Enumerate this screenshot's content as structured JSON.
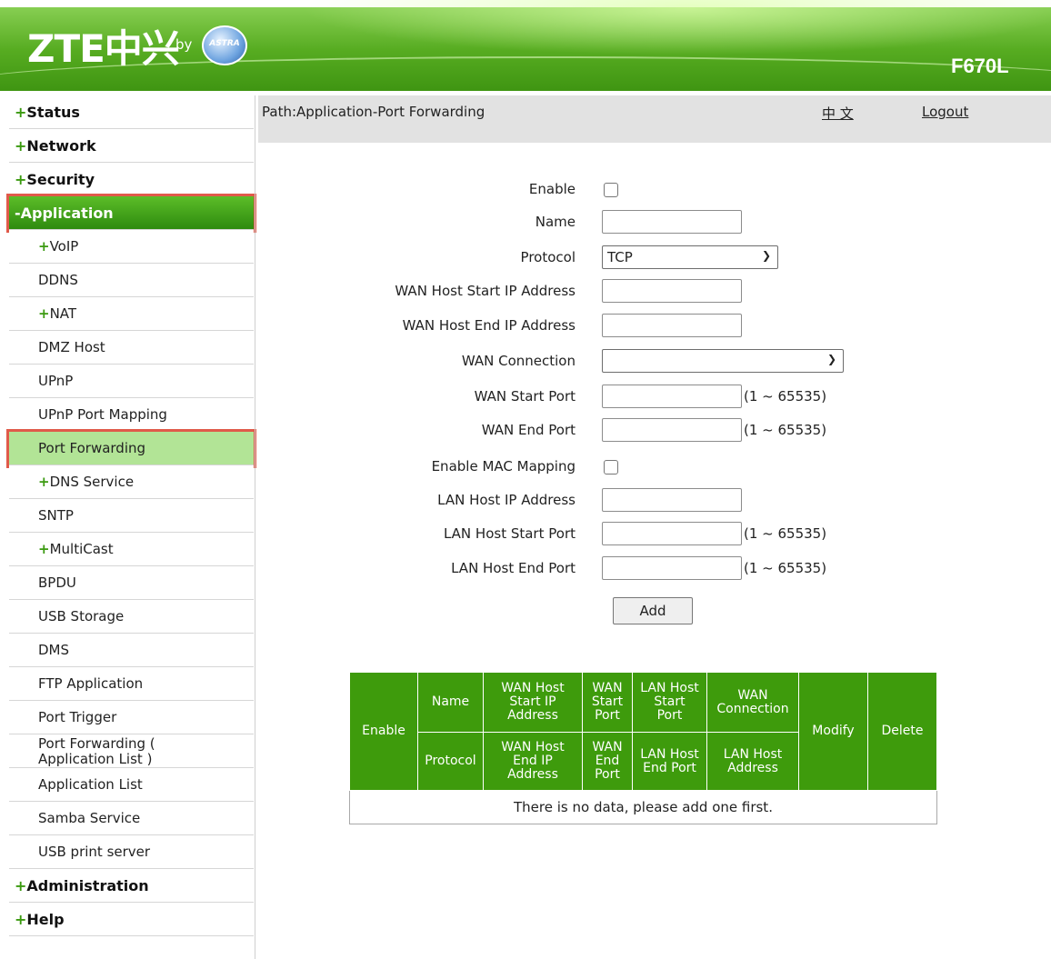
{
  "header": {
    "logo_text": "ZTE中兴",
    "logo_by": "by",
    "partner_logo": "ASTRA",
    "model": "F670L"
  },
  "sidebar": {
    "items": [
      {
        "label": "Status",
        "level": "top",
        "plus": true
      },
      {
        "label": "Network",
        "level": "top",
        "plus": true
      },
      {
        "label": "Security",
        "level": "top",
        "plus": true
      },
      {
        "label": "Application",
        "level": "top",
        "minus": true,
        "active": true
      },
      {
        "label": "VoIP",
        "level": "sub",
        "plus": true
      },
      {
        "label": "DDNS",
        "level": "sub"
      },
      {
        "label": "NAT",
        "level": "sub",
        "plus": true
      },
      {
        "label": "DMZ Host",
        "level": "sub"
      },
      {
        "label": "UPnP",
        "level": "sub"
      },
      {
        "label": "UPnP Port Mapping",
        "level": "sub"
      },
      {
        "label": "Port Forwarding",
        "level": "sub",
        "active": true
      },
      {
        "label": "DNS Service",
        "level": "sub",
        "plus": true
      },
      {
        "label": "SNTP",
        "level": "sub"
      },
      {
        "label": "MultiCast",
        "level": "sub",
        "plus": true
      },
      {
        "label": "BPDU",
        "level": "sub"
      },
      {
        "label": "USB Storage",
        "level": "sub"
      },
      {
        "label": "DMS",
        "level": "sub"
      },
      {
        "label": "FTP Application",
        "level": "sub"
      },
      {
        "label": "Port Trigger",
        "level": "sub"
      },
      {
        "label": "Port Forwarding ( Application List )",
        "level": "sub",
        "two_line": [
          "Port Forwarding (",
          " Application List )"
        ]
      },
      {
        "label": "Application List",
        "level": "sub"
      },
      {
        "label": "Samba Service",
        "level": "sub"
      },
      {
        "label": "USB print server",
        "level": "sub"
      },
      {
        "label": "Administration",
        "level": "top",
        "plus": true
      },
      {
        "label": "Help",
        "level": "top",
        "plus": true
      }
    ]
  },
  "pathbar": {
    "path": "Path:Application-Port Forwarding",
    "lang": "中 文",
    "logout": "Logout"
  },
  "form": {
    "enable_label": "Enable",
    "enable_checked": false,
    "name_label": "Name",
    "name_value": "",
    "protocol_label": "Protocol",
    "protocol_value": "TCP",
    "wan_host_start_ip_label": "WAN Host Start IP Address",
    "wan_host_end_ip_label": "WAN Host End IP Address",
    "wan_connection_label": "WAN Connection",
    "wan_connection_value": "",
    "wan_start_port_label": "WAN Start Port",
    "wan_end_port_label": "WAN End Port",
    "enable_mac_mapping_label": "Enable MAC Mapping",
    "lan_host_ip_label": "LAN Host IP Address",
    "lan_host_start_port_label": "LAN Host Start Port",
    "lan_host_end_port_label": "LAN Host End Port",
    "port_range_hint": "(1 ~ 65535)",
    "add_button": "Add"
  },
  "table": {
    "headers": {
      "enable": "Enable",
      "name": "Name",
      "wan_host_start_ip": [
        "WAN Host",
        "Start IP",
        "Address"
      ],
      "wan_start_port": [
        "WAN",
        "Start",
        "Port"
      ],
      "lan_host_start_port": [
        "LAN Host",
        "Start",
        "Port"
      ],
      "wan_connection": [
        "WAN",
        "Connection"
      ],
      "modify": "Modify",
      "delete": "Delete",
      "protocol": "Protocol",
      "wan_host_end_ip": [
        "WAN Host",
        "End IP",
        "Address"
      ],
      "wan_end_port": [
        "WAN",
        "End",
        "Port"
      ],
      "lan_host_end_port": [
        "LAN Host",
        "End Port"
      ],
      "lan_host_address": [
        "LAN Host",
        "Address"
      ]
    },
    "empty_message": "There is no data, please add one first."
  },
  "colors": {
    "brand_green": "#3e9b0c",
    "highlight_border": "#e05a4a",
    "active_sub_bg": "#b2e496"
  }
}
